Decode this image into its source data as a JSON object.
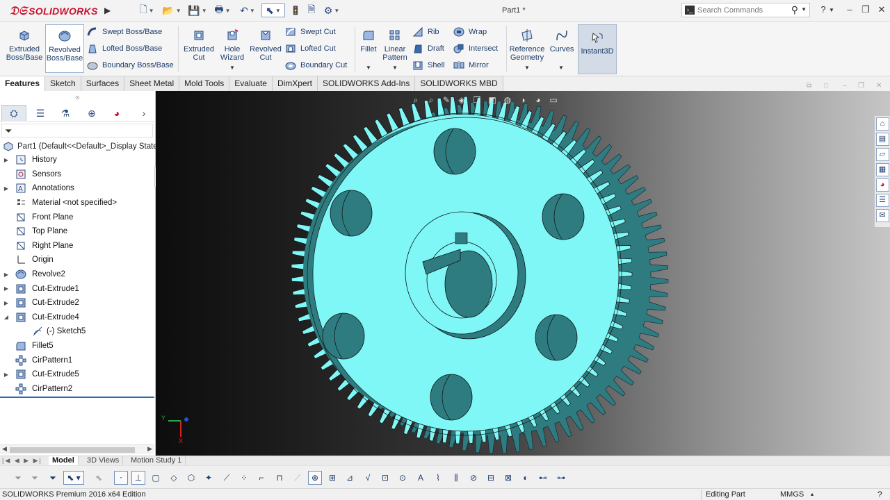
{
  "app": {
    "brand": "SOLIDWORKS",
    "document_title": "Part1 *",
    "edition": "SOLIDWORKS Premium 2016 x64 Edition",
    "accent_color": "#c8102e"
  },
  "search": {
    "placeholder": "Search Commands"
  },
  "ribbon": {
    "extruded_boss": "Extruded Boss/Base",
    "revolved_boss": "Revolved Boss/Base",
    "swept_boss": "Swept Boss/Base",
    "lofted_boss": "Lofted Boss/Base",
    "boundary_boss": "Boundary Boss/Base",
    "extruded_cut": "Extruded Cut",
    "hole_wizard": "Hole Wizard",
    "revolved_cut": "Revolved Cut",
    "swept_cut": "Swept Cut",
    "lofted_cut": "Lofted Cut",
    "boundary_cut": "Boundary Cut",
    "fillet": "Fillet",
    "linear_pattern": "Linear Pattern",
    "rib": "Rib",
    "draft": "Draft",
    "shell": "Shell",
    "wrap": "Wrap",
    "intersect": "Intersect",
    "mirror": "Mirror",
    "reference_geometry": "Reference Geometry",
    "curves": "Curves",
    "instant3d": "Instant3D"
  },
  "cm_tabs": [
    "Features",
    "Sketch",
    "Surfaces",
    "Sheet Metal",
    "Mold Tools",
    "Evaluate",
    "DimXpert",
    "SOLIDWORKS Add-Ins",
    "SOLIDWORKS MBD"
  ],
  "tree": {
    "root": "Part1  (Default<<Default>_Display State",
    "items": [
      {
        "label": "History",
        "icon": "history-icon",
        "expandable": true,
        "indent": 0
      },
      {
        "label": "Sensors",
        "icon": "sensors-icon",
        "expandable": false,
        "indent": 0
      },
      {
        "label": "Annotations",
        "icon": "annotations-icon",
        "expandable": true,
        "indent": 0
      },
      {
        "label": "Material <not specified>",
        "icon": "material-icon",
        "expandable": false,
        "indent": 0
      },
      {
        "label": "Front Plane",
        "icon": "plane-icon",
        "expandable": false,
        "indent": 0
      },
      {
        "label": "Top Plane",
        "icon": "plane-icon",
        "expandable": false,
        "indent": 0
      },
      {
        "label": "Right Plane",
        "icon": "plane-icon",
        "expandable": false,
        "indent": 0
      },
      {
        "label": "Origin",
        "icon": "origin-icon",
        "expandable": false,
        "indent": 0
      },
      {
        "label": "Revolve2",
        "icon": "revolve-icon",
        "expandable": true,
        "indent": 0
      },
      {
        "label": "Cut-Extrude1",
        "icon": "cut-extrude-icon",
        "expandable": true,
        "indent": 0
      },
      {
        "label": "Cut-Extrude2",
        "icon": "cut-extrude-icon",
        "expandable": true,
        "indent": 0
      },
      {
        "label": "Cut-Extrude4",
        "icon": "cut-extrude-icon",
        "expandable": true,
        "expanded": true,
        "indent": 0
      },
      {
        "label": "(-) Sketch5",
        "icon": "sketch-icon",
        "expandable": false,
        "indent": 1
      },
      {
        "label": "Fillet5",
        "icon": "fillet-icon",
        "expandable": false,
        "indent": 0
      },
      {
        "label": "CirPattern1",
        "icon": "cirpattern-icon",
        "expandable": false,
        "indent": 0
      },
      {
        "label": "Cut-Extrude5",
        "icon": "cut-extrude-icon",
        "expandable": true,
        "indent": 0
      },
      {
        "label": "CirPattern2",
        "icon": "cirpattern-icon",
        "expandable": false,
        "indent": 0
      }
    ]
  },
  "bottom_tabs": [
    "Model",
    "3D Views",
    "Motion Study 1"
  ],
  "status": {
    "mode": "Editing Part",
    "units": "MMGS",
    "help": "?"
  },
  "model": {
    "face_color": "#7ff7f7",
    "dark_color": "#2e7c80",
    "background_left": "#0d0d0d",
    "background_right": "#c6c6c6",
    "teeth_count": 80
  },
  "triad": {
    "y": "Y",
    "x": "X"
  }
}
